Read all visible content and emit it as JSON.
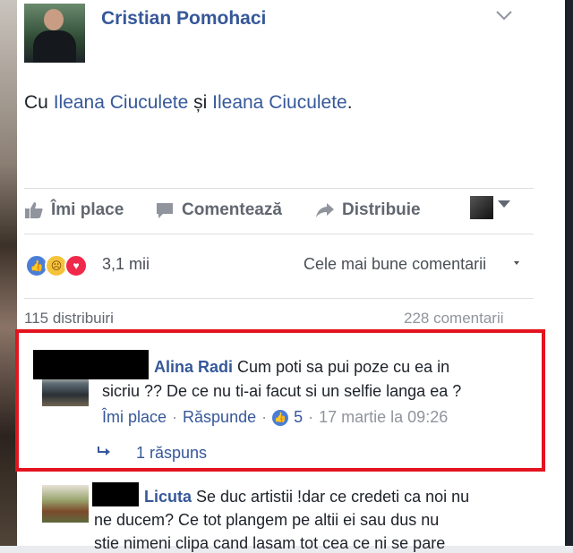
{
  "post": {
    "author": "Cristian Pomohaci",
    "text_prefix": "Cu ",
    "tag1": "Ileana Ciuculete",
    "text_middle": " și ",
    "tag2": "Ileana Ciuculete",
    "text_suffix": "."
  },
  "actions": {
    "like": "Îmi place",
    "comment": "Comentează",
    "share": "Distribuie"
  },
  "stats": {
    "reactions_count": "3,1 mii",
    "sort_label": "Cele mai bune comentarii",
    "shares": "115 distribuiri",
    "comments": "228 comentarii"
  },
  "comments": [
    {
      "author": "Alina Radi",
      "line1": " Cum poti sa pui poze cu ea in",
      "line2": "sicriu ?? De ce nu ti-ai facut si un selfie langa ea ?",
      "like_label": "Îmi place",
      "reply_label": "Răspunde",
      "likes": "5",
      "date": "17 martie la 09:26",
      "replies": "1 răspuns"
    },
    {
      "author": "Licuta",
      "line1": " Se duc artistii !dar ce credeti ca noi nu",
      "line2": "ne ducem? Ce tot plangem pe altii ei sau dus nu",
      "line3": "stie nimeni clipa cand lasam tot cea ce ni se pare"
    }
  ],
  "colors": {
    "link_blue": "#365899",
    "highlight_red": "#e3131f",
    "like_blue": "#4a7ed6",
    "love_red": "#f0284a"
  },
  "icons": [
    "thumbs-up-icon",
    "comment-icon",
    "share-icon",
    "chevron-down-icon",
    "reply-arrow-icon"
  ]
}
